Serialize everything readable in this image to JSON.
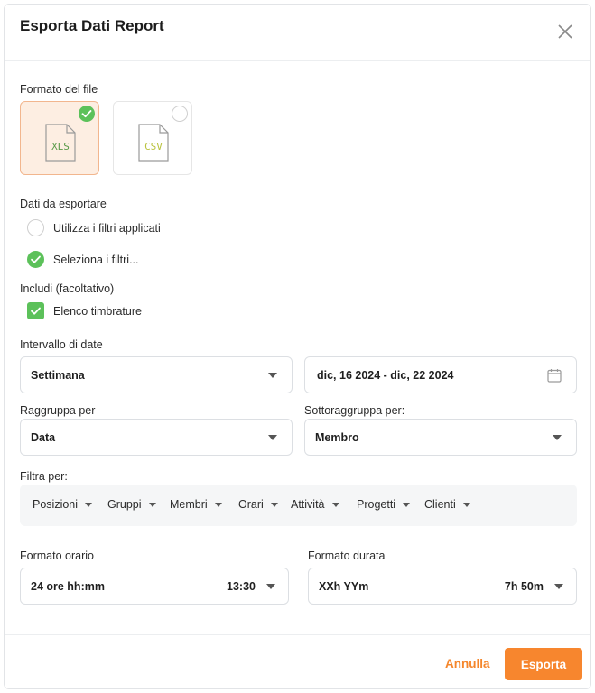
{
  "dialog": {
    "title": "Esporta Dati Report"
  },
  "file_format": {
    "label": "Formato del file",
    "options": [
      {
        "name": "XLS",
        "selected": true
      },
      {
        "name": "CSV",
        "selected": false
      }
    ]
  },
  "data_export": {
    "label": "Dati da esportare",
    "options": [
      {
        "label": "Utilizza i filtri applicati",
        "selected": false
      },
      {
        "label": "Seleziona i filtri...",
        "selected": true
      }
    ]
  },
  "include": {
    "label": "Includi (facoltativo)",
    "option": {
      "label": "Elenco timbrature",
      "checked": true
    }
  },
  "date_range": {
    "label": "Intervallo di date",
    "period": "Settimana",
    "range": "dic, 16 2024 - dic, 22 2024"
  },
  "group_by": {
    "label": "Raggruppa per",
    "value": "Data"
  },
  "subgroup_by": {
    "label": "Sottoraggruppa per:",
    "value": "Membro"
  },
  "filter_by": {
    "label": "Filtra per:",
    "items": [
      "Posizioni",
      "Gruppi",
      "Membri",
      "Orari",
      "Attività",
      "Progetti",
      "Clienti"
    ]
  },
  "time_format": {
    "label": "Formato orario",
    "value": "24 ore hh:mm",
    "example": "13:30"
  },
  "duration_format": {
    "label": "Formato durata",
    "value": "XXh YYm",
    "example": "7h 50m"
  },
  "actions": {
    "cancel": "Annulla",
    "export": "Esporta"
  },
  "colors": {
    "accent": "#f7862e",
    "check": "#5cc15a",
    "xls_icon": "#5a9a49",
    "csv_icon": "#b9c23c"
  }
}
